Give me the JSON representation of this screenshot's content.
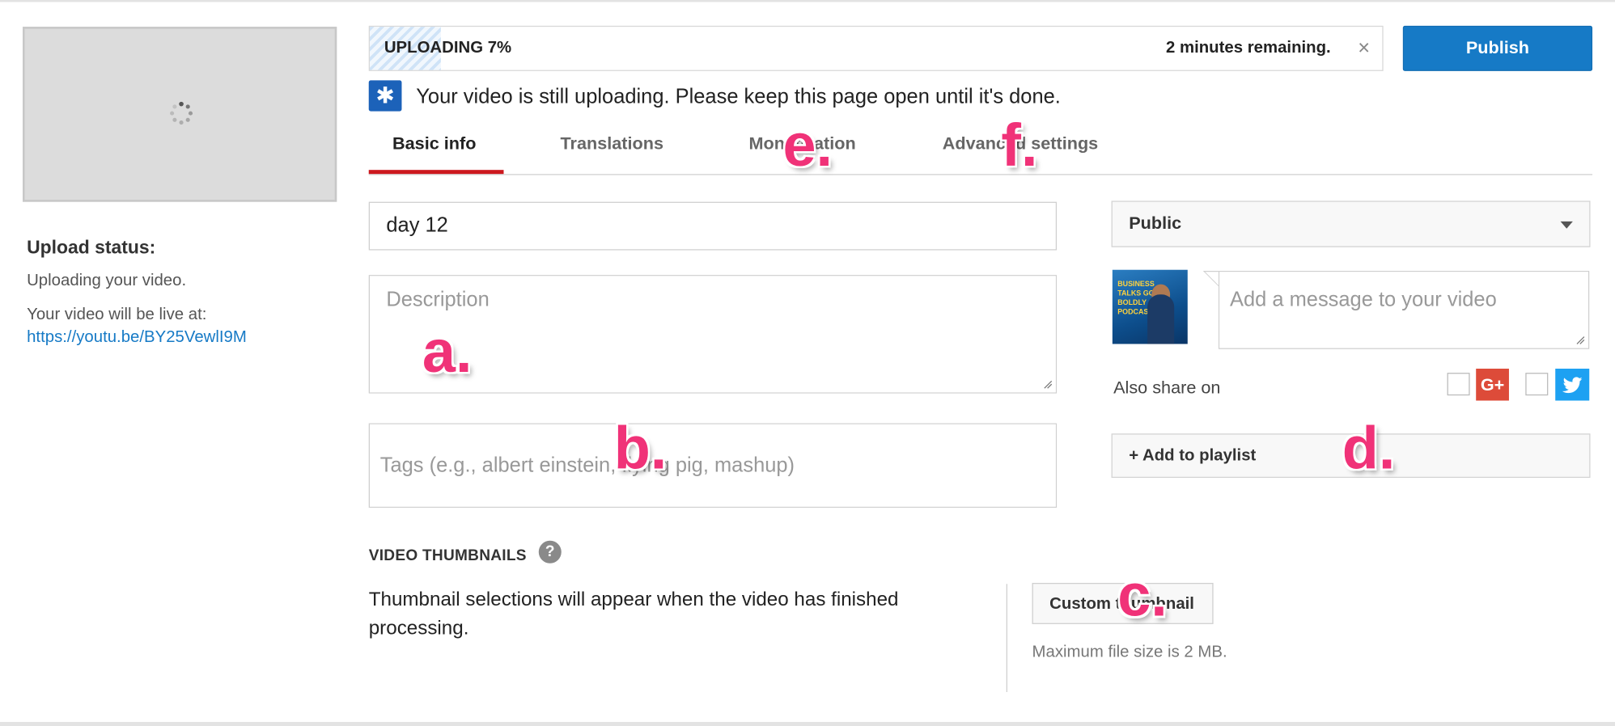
{
  "upload": {
    "label": "UPLOADING 7%",
    "progress_percent": 7,
    "remaining": "2 minutes remaining.",
    "close_glyph": "×"
  },
  "publish_label": "Publish",
  "notice": {
    "text": "Your video is still uploading. Please keep this page open until it's done.",
    "icon": "asterisk-icon",
    "color": "#1c62b9"
  },
  "left": {
    "status_title": "Upload status:",
    "status_text": "Uploading your video.",
    "live_text": "Your video will be live at:",
    "live_link": "https://youtu.be/BY25VewlI9M"
  },
  "tabs": [
    {
      "label": "Basic info",
      "active": true
    },
    {
      "label": "Translations",
      "active": false
    },
    {
      "label": "Monetization",
      "active": false
    },
    {
      "label": "Advanced settings",
      "active": false
    }
  ],
  "form": {
    "title_value": "day 12",
    "description_placeholder": "Description",
    "tags_placeholder": "Tags (e.g., albert einstein, flying pig, mashup)"
  },
  "share": {
    "privacy_value": "Public",
    "message_placeholder": "Add a message to your video",
    "also_share": "Also share on",
    "gplus_label": "G+",
    "playlist_label": "+ Add to playlist",
    "avatar_text": "BUSINESS TALKS GO BOLDLY PODCAST"
  },
  "thumbnails": {
    "title": "VIDEO THUMBNAILS",
    "help_glyph": "?",
    "message": "Thumbnail selections will appear when the video has finished processing.",
    "custom_button": "Custom thumbnail",
    "max_size": "Maximum file size is 2 MB."
  },
  "annotations": {
    "a": "a.",
    "b": "b.",
    "c": "c.",
    "d": "d.",
    "e": "e.",
    "f": "f."
  },
  "colors": {
    "accent": "#167ac6",
    "tab_active": "#cc181e",
    "annotation": "#f03278",
    "gplus": "#dd4b39",
    "twitter": "#1da1f2"
  }
}
